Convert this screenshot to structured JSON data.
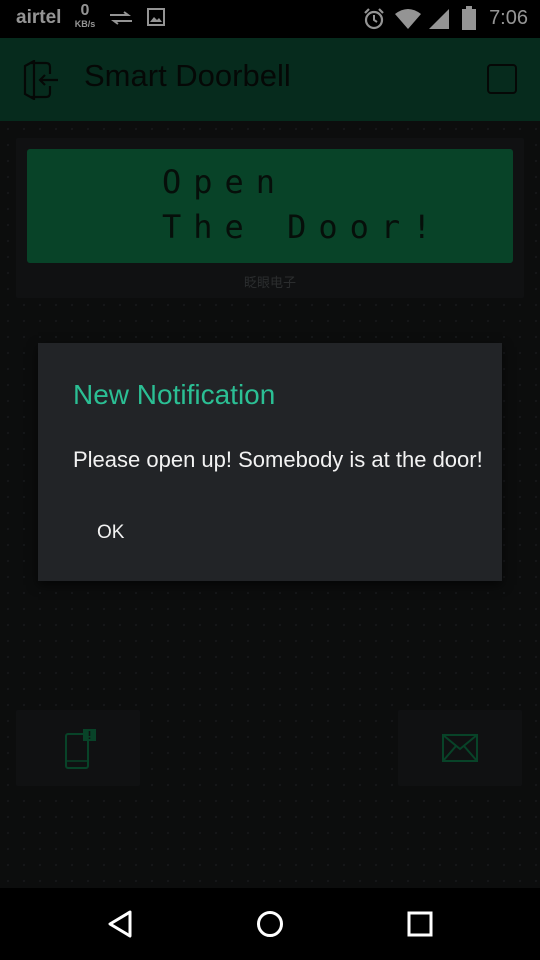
{
  "status_bar": {
    "carrier": "airtel",
    "speed_value": "0",
    "speed_unit": "KB/s",
    "time": "7:06"
  },
  "app_bar": {
    "title": "Smart Doorbell"
  },
  "lcd": {
    "line1": "Open",
    "line2": "The Door!",
    "caption": "眨眼电子"
  },
  "dialog": {
    "title": "New Notification",
    "message": "Please open up! Somebody is at the door!",
    "ok_label": "OK"
  },
  "colors": {
    "accent": "#2bbf94",
    "app_bar": "#0b4a33",
    "lcd_background": "#0f7446",
    "canvas": "#151718"
  },
  "icons": {
    "back": "exit-arrow-icon",
    "phone_notification": "phone-notification-icon",
    "mail": "envelope-icon"
  }
}
